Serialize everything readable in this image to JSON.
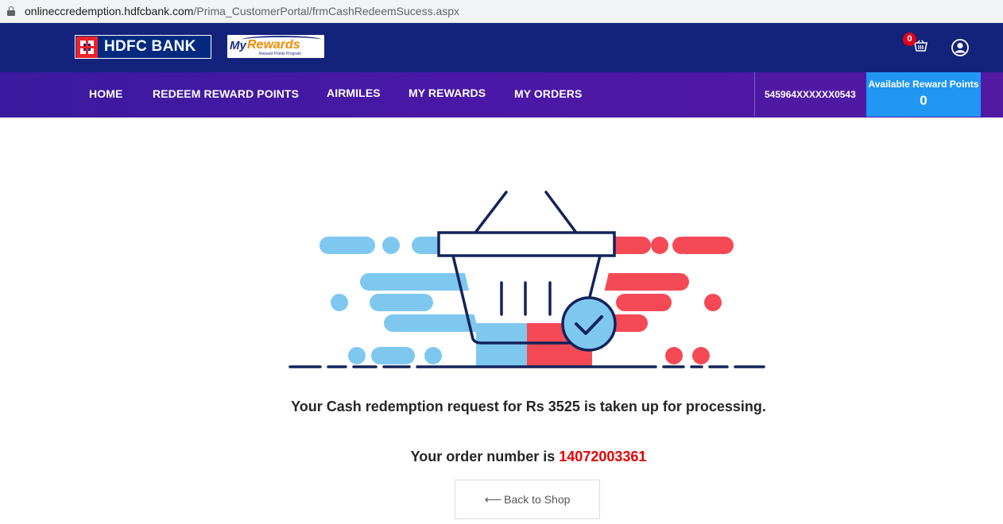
{
  "browser": {
    "url_host": "onlineccredemption.hdfcbank.com",
    "url_path": "/Prima_CustomerPortal/frmCashRedeemSucess.aspx"
  },
  "header": {
    "bank_name": "HDFC BANK",
    "rewards_logo": {
      "my": "My",
      "rewards": "Rewards",
      "tagline": "Reward Points Program"
    },
    "cart_count": "0"
  },
  "nav": {
    "items": [
      {
        "label": "HOME"
      },
      {
        "label": "REDEEM REWARD POINTS"
      },
      {
        "label": "AIRMILES"
      },
      {
        "label": "MY REWARDS"
      },
      {
        "label": "MY ORDERS"
      }
    ],
    "card_number": "545964XXXXXX0543",
    "points_label": "Available Reward Points",
    "points_value": "0"
  },
  "main": {
    "message": "Your Cash redemption request for Rs 3525 is taken up for processing.",
    "order_label": "Your order number is ",
    "order_number": "14072003361",
    "back_arrow": "⟵",
    "back_label": "Back to Shop"
  },
  "colors": {
    "header_bg": "#13237c",
    "nav_bg": "#4a17a6",
    "points_bg": "#2196f3",
    "order_number": "#e50000",
    "illus_blue": "#7ec8f0",
    "illus_red": "#f54a55",
    "illus_navy": "#13235a"
  }
}
